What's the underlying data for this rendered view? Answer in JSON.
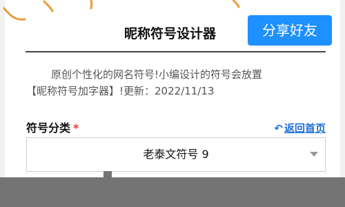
{
  "header": {
    "title": "昵称符号设计器",
    "share_label": "分享好友"
  },
  "description": {
    "line1": "原创个性化的网名符号!小编设计的符号会放置",
    "line2": "【昵称符号加字器】!更新：2022/11/13"
  },
  "category": {
    "label": "符号分类",
    "required_mark": "*",
    "back_label": "返回首页",
    "back_icon": "undo-arrow-icon",
    "selected_value": "老泰文符号 9"
  },
  "colors": {
    "accent": "#1e90ff",
    "link": "#1e6fd6",
    "required": "#e53935",
    "doodle": "#ec9a3a"
  }
}
